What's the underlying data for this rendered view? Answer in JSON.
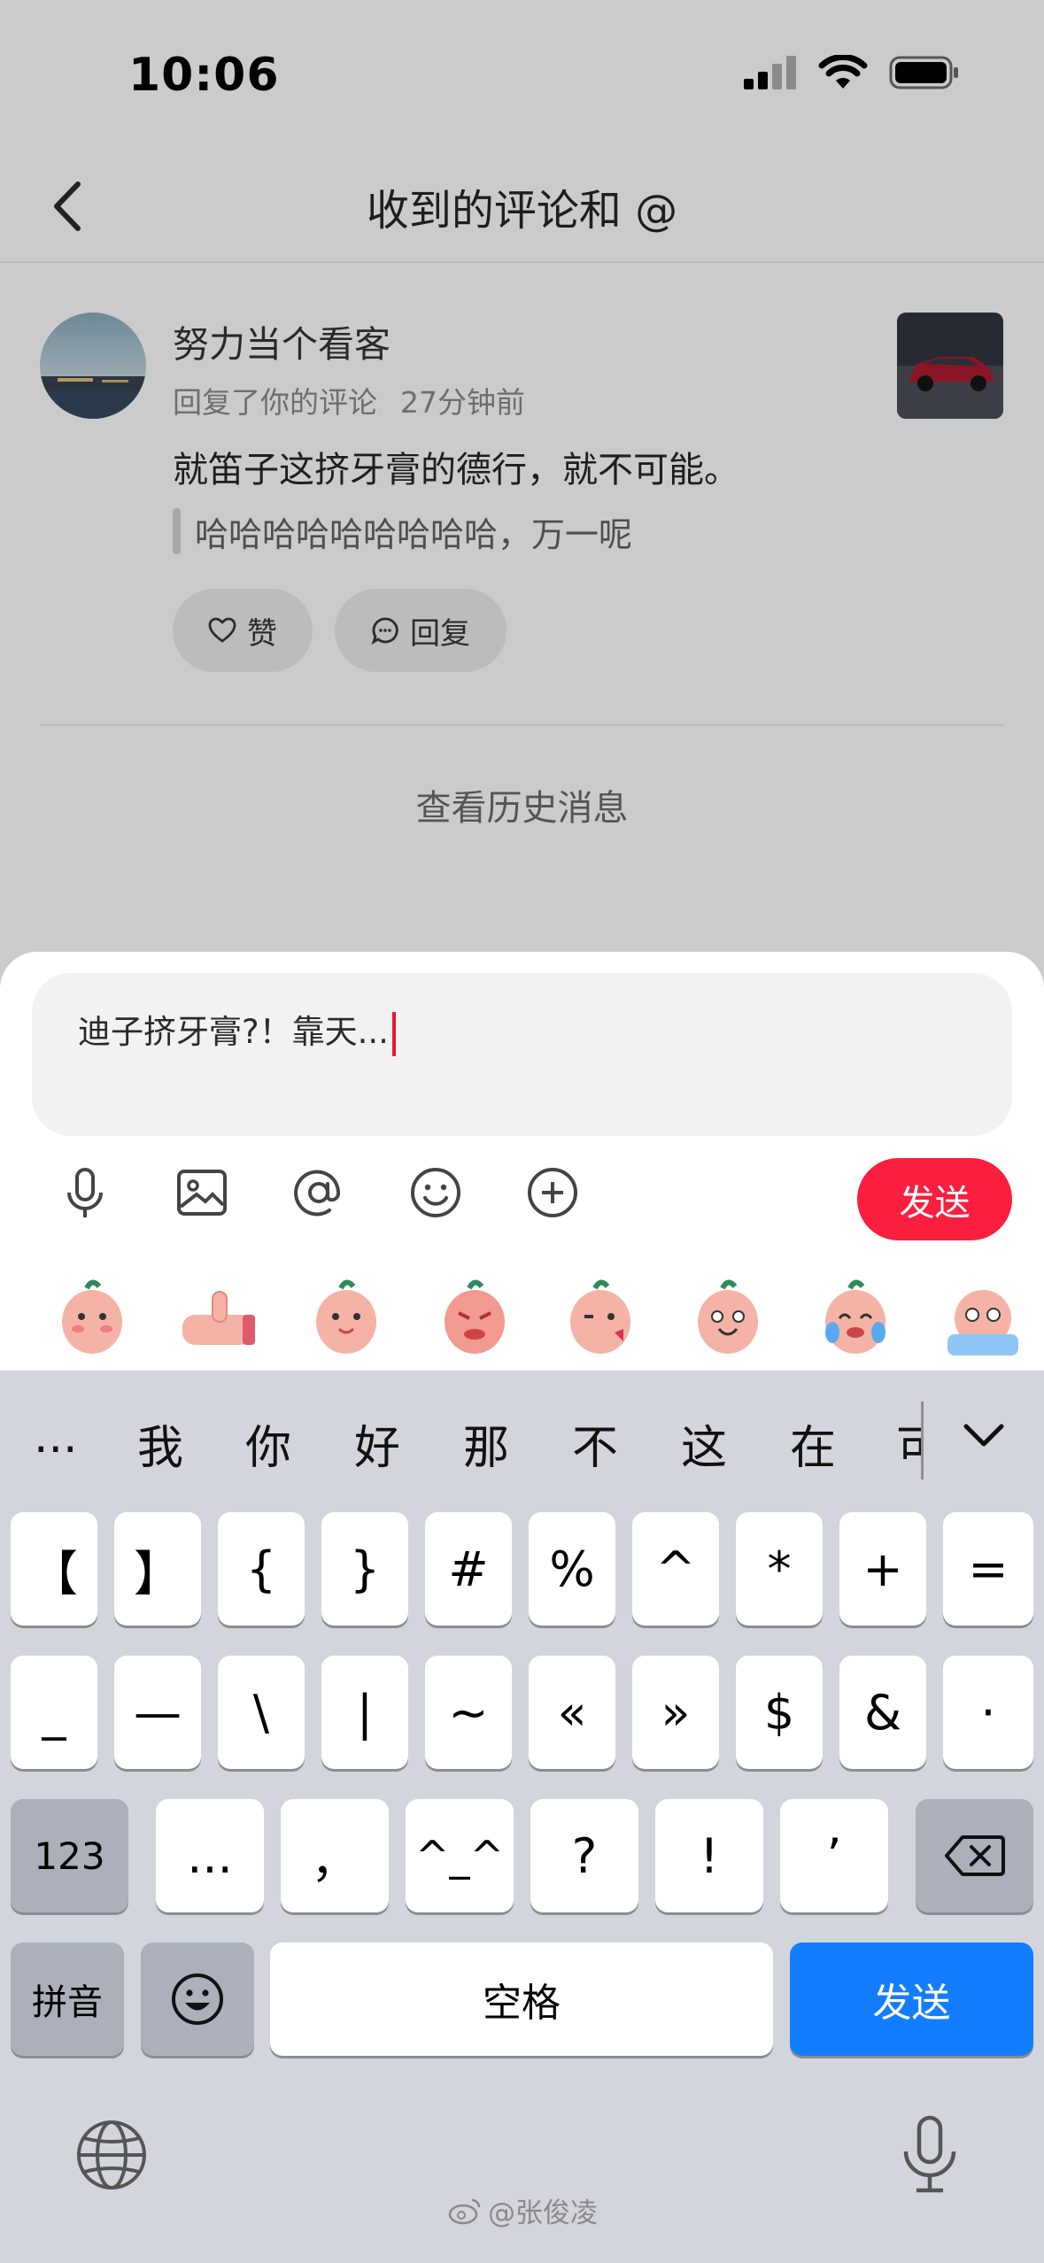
{
  "status_bar": {
    "time": "10:06"
  },
  "nav": {
    "title": "收到的评论和 @"
  },
  "comment": {
    "username": "努力当个看客",
    "action": "回复了你的评论",
    "time_ago": "27分钟前",
    "text": "就笛子这挤牙膏的德行，就不可能。",
    "quote": "哈哈哈哈哈哈哈哈哈，万一呢",
    "like_label": "赞",
    "reply_label": "回复"
  },
  "history_link": "查看历史消息",
  "composer": {
    "input_value": "迪子挤牙膏?！靠天...",
    "send_label": "发送",
    "tools": [
      "microphone-icon",
      "image-icon",
      "at-icon",
      "emoji-icon",
      "plus-icon"
    ],
    "sticker_count": 8
  },
  "keyboard": {
    "candidates": [
      "...",
      "我",
      "你",
      "好",
      "那",
      "不",
      "这",
      "在",
      "可"
    ],
    "row1": [
      "【",
      "】",
      "{",
      "}",
      "#",
      "%",
      "^",
      "*",
      "+",
      "="
    ],
    "row2": [
      "_",
      "—",
      "\\",
      "|",
      "~",
      "«",
      "»",
      "$",
      "&",
      "·"
    ],
    "row3_left": "123",
    "row3": [
      "...",
      "，",
      "^_^",
      "?",
      "!",
      "’"
    ],
    "pinyin": "拼音",
    "space": "空格",
    "send": "发送"
  },
  "watermark": "@张俊凌",
  "colors": {
    "accent_red": "#fb1e3e",
    "keyboard_blue": "#127eff"
  }
}
